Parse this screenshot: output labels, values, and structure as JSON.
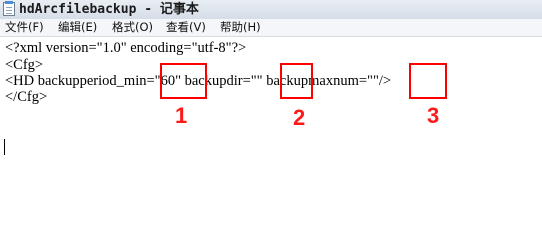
{
  "window": {
    "title": "hdArcfilebackup - 记事本"
  },
  "menu": [
    {
      "label": "文件(F)"
    },
    {
      "label": "编辑(E)"
    },
    {
      "label": "格式(O)"
    },
    {
      "label": "查看(V)"
    },
    {
      "label": "帮助(H)"
    }
  ],
  "editor": {
    "lines": [
      "<?xml version=\"1.0\" encoding=\"utf-8\"?>",
      "<Cfg>",
      "<HD backupperiod_min=\"60\" backupdir=\"\" backupmaxnum=\"\"/>",
      "</Cfg>"
    ]
  },
  "annotations": {
    "color": "#ff0000",
    "labels": [
      "1",
      "2",
      "3"
    ]
  }
}
